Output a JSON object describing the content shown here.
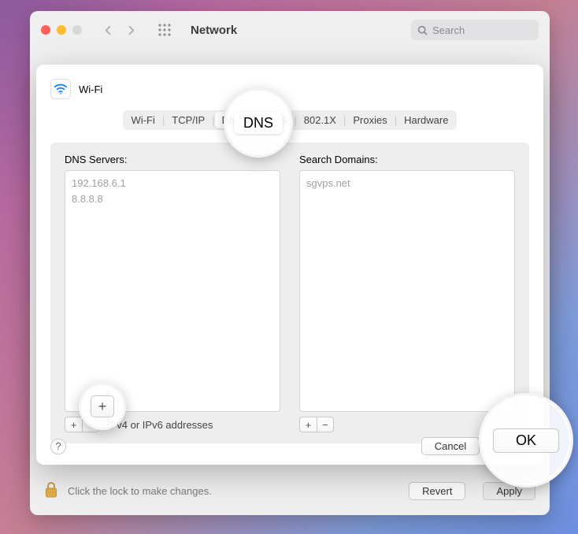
{
  "window": {
    "title": "Network",
    "search_placeholder": "Search"
  },
  "sheet": {
    "wifi_label": "Wi-Fi",
    "tabs": [
      "Wi-Fi",
      "TCP/IP",
      "DNS",
      "WINS",
      "802.1X",
      "Proxies",
      "Hardware"
    ],
    "active_tab_index": 2,
    "dns": {
      "servers_label": "DNS Servers:",
      "servers": [
        "192.168.6.1",
        "8.8.8.8"
      ],
      "servers_hint": "IPv4 or IPv6 addresses",
      "domains_label": "Search Domains:",
      "domains": [
        "sgvps.net"
      ],
      "add_label": "+",
      "remove_label": "−"
    },
    "help_label": "?",
    "cancel_label": "Cancel",
    "ok_label": "OK"
  },
  "lockrow": {
    "text": "Click the lock to make changes.",
    "revert_label": "Revert",
    "apply_label": "Apply"
  },
  "enlarged": {
    "dns_label": "DNS",
    "add_label": "+",
    "ok_label": "OK"
  }
}
